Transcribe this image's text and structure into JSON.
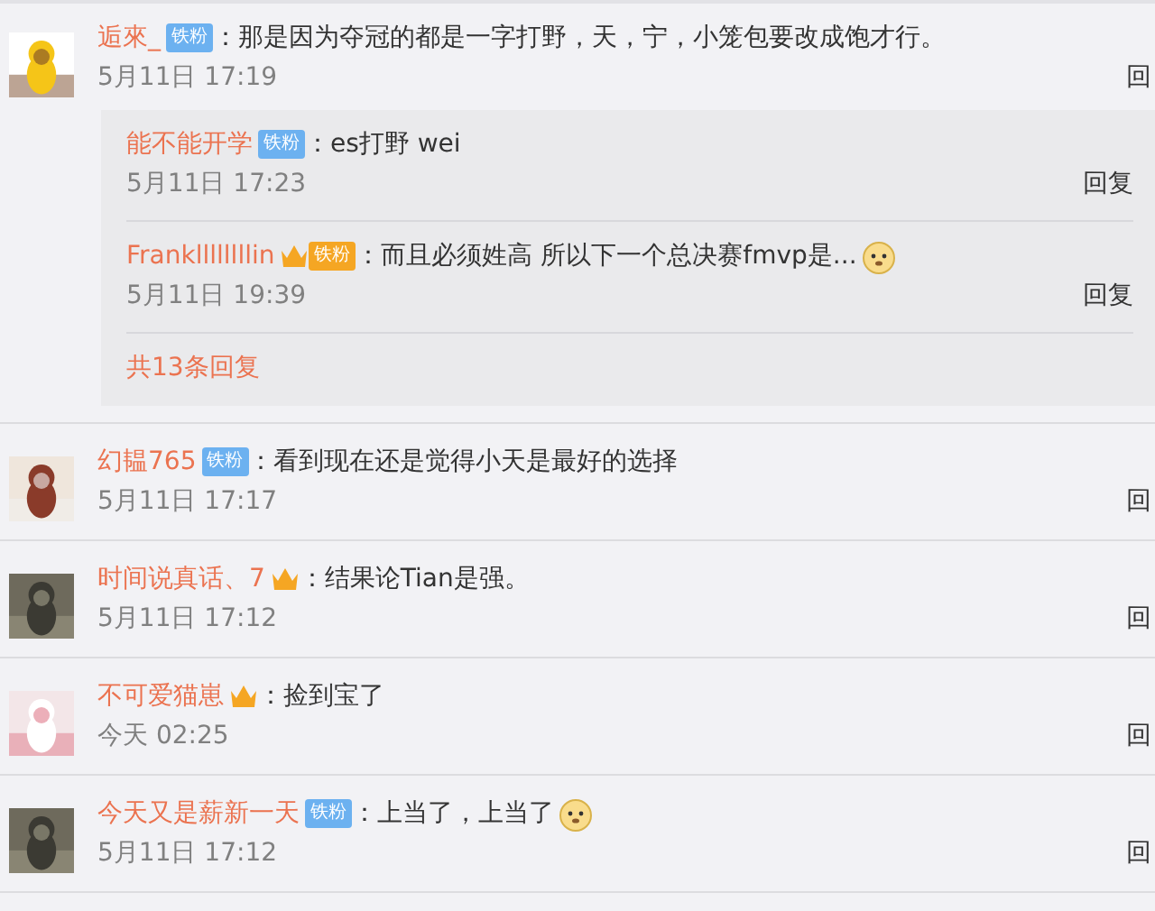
{
  "comments": [
    {
      "user": "逅來_",
      "badge": {
        "kind": "fan",
        "text": "铁粉"
      },
      "text": "：那是因为夺冠的都是一字打野，天，宁，小笼包要改成饱才行。",
      "emoji": false,
      "time": "5月11日 17:19",
      "reply": "回",
      "replies": [
        {
          "user": "能不能开学",
          "badge": {
            "kind": "fan",
            "text": "铁粉"
          },
          "text": "：es打野 wei",
          "emoji": false,
          "time": "5月11日 17:23",
          "reply": "回复"
        },
        {
          "user": "Frankllllllllin",
          "badge": {
            "kind": "crown-fan",
            "text": "铁粉"
          },
          "text": "：而且必须姓高 所以下一个总决赛fmvp是...",
          "emoji": true,
          "time": "5月11日 19:39",
          "reply": "回复"
        }
      ],
      "more": "共13条回复"
    },
    {
      "user": "幻韫765",
      "badge": {
        "kind": "fan",
        "text": "铁粉"
      },
      "text": "：看到现在还是觉得小天是最好的选择",
      "emoji": false,
      "time": "5月11日 17:17",
      "reply": "回"
    },
    {
      "user": "时间说真话、7",
      "badge": {
        "kind": "crown"
      },
      "text": "：结果论Tian是强。",
      "emoji": false,
      "time": "5月11日 17:12",
      "reply": "回"
    },
    {
      "user": "不可爱猫崽",
      "badge": {
        "kind": "crown"
      },
      "text": "：捡到宝了",
      "emoji": false,
      "time": "今天 02:25",
      "reply": "回"
    },
    {
      "user": "今天又是薪新一天",
      "badge": {
        "kind": "fan",
        "text": "铁粉"
      },
      "text": "：上当了，上当了",
      "emoji": true,
      "time": "5月11日 17:12",
      "reply": "回"
    }
  ]
}
